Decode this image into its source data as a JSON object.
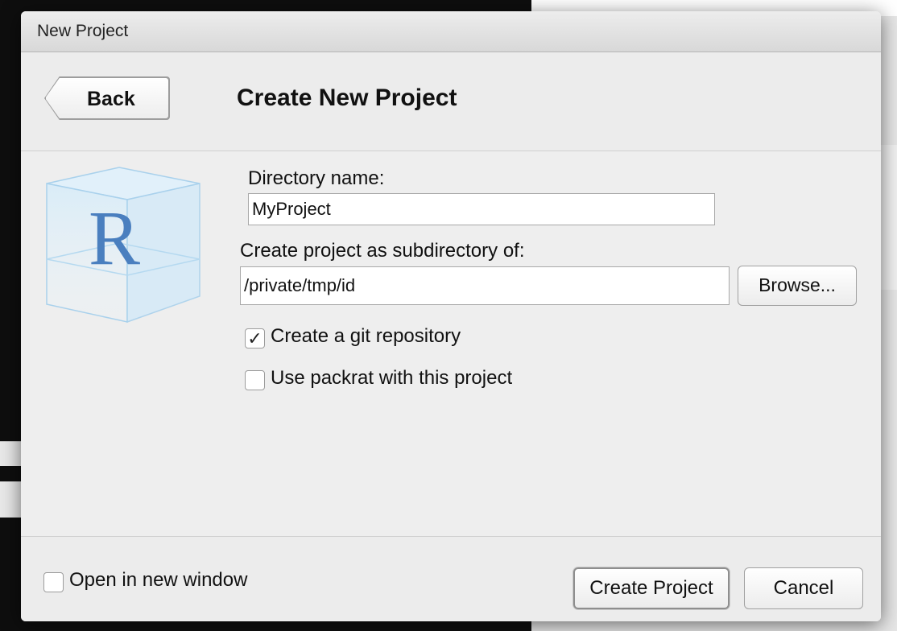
{
  "dialog": {
    "window_title": "New Project",
    "back_label": "Back",
    "heading": "Create New Project",
    "logo_letter": "R"
  },
  "form": {
    "directory_name_label": "Directory name:",
    "directory_name_value": "MyProject",
    "subdirectory_label": "Create project as subdirectory of:",
    "subdirectory_value": "/private/tmp/id",
    "browse_label": "Browse...",
    "git_label": "Create a git repository",
    "git_checked": true,
    "packrat_label": "Use packrat with this project",
    "packrat_checked": false
  },
  "footer": {
    "open_new_window_label": "Open in new window",
    "open_new_window_checked": false,
    "create_label": "Create Project",
    "cancel_label": "Cancel"
  },
  "colors": {
    "dialog_bg": "#ebebeb",
    "logo_blue": "#4a7fbf",
    "cube_blue": "#cfe6f5"
  },
  "icons": {
    "back": "left-arrow-shape",
    "logo": "r-cube-logo",
    "check": "checkmark"
  }
}
